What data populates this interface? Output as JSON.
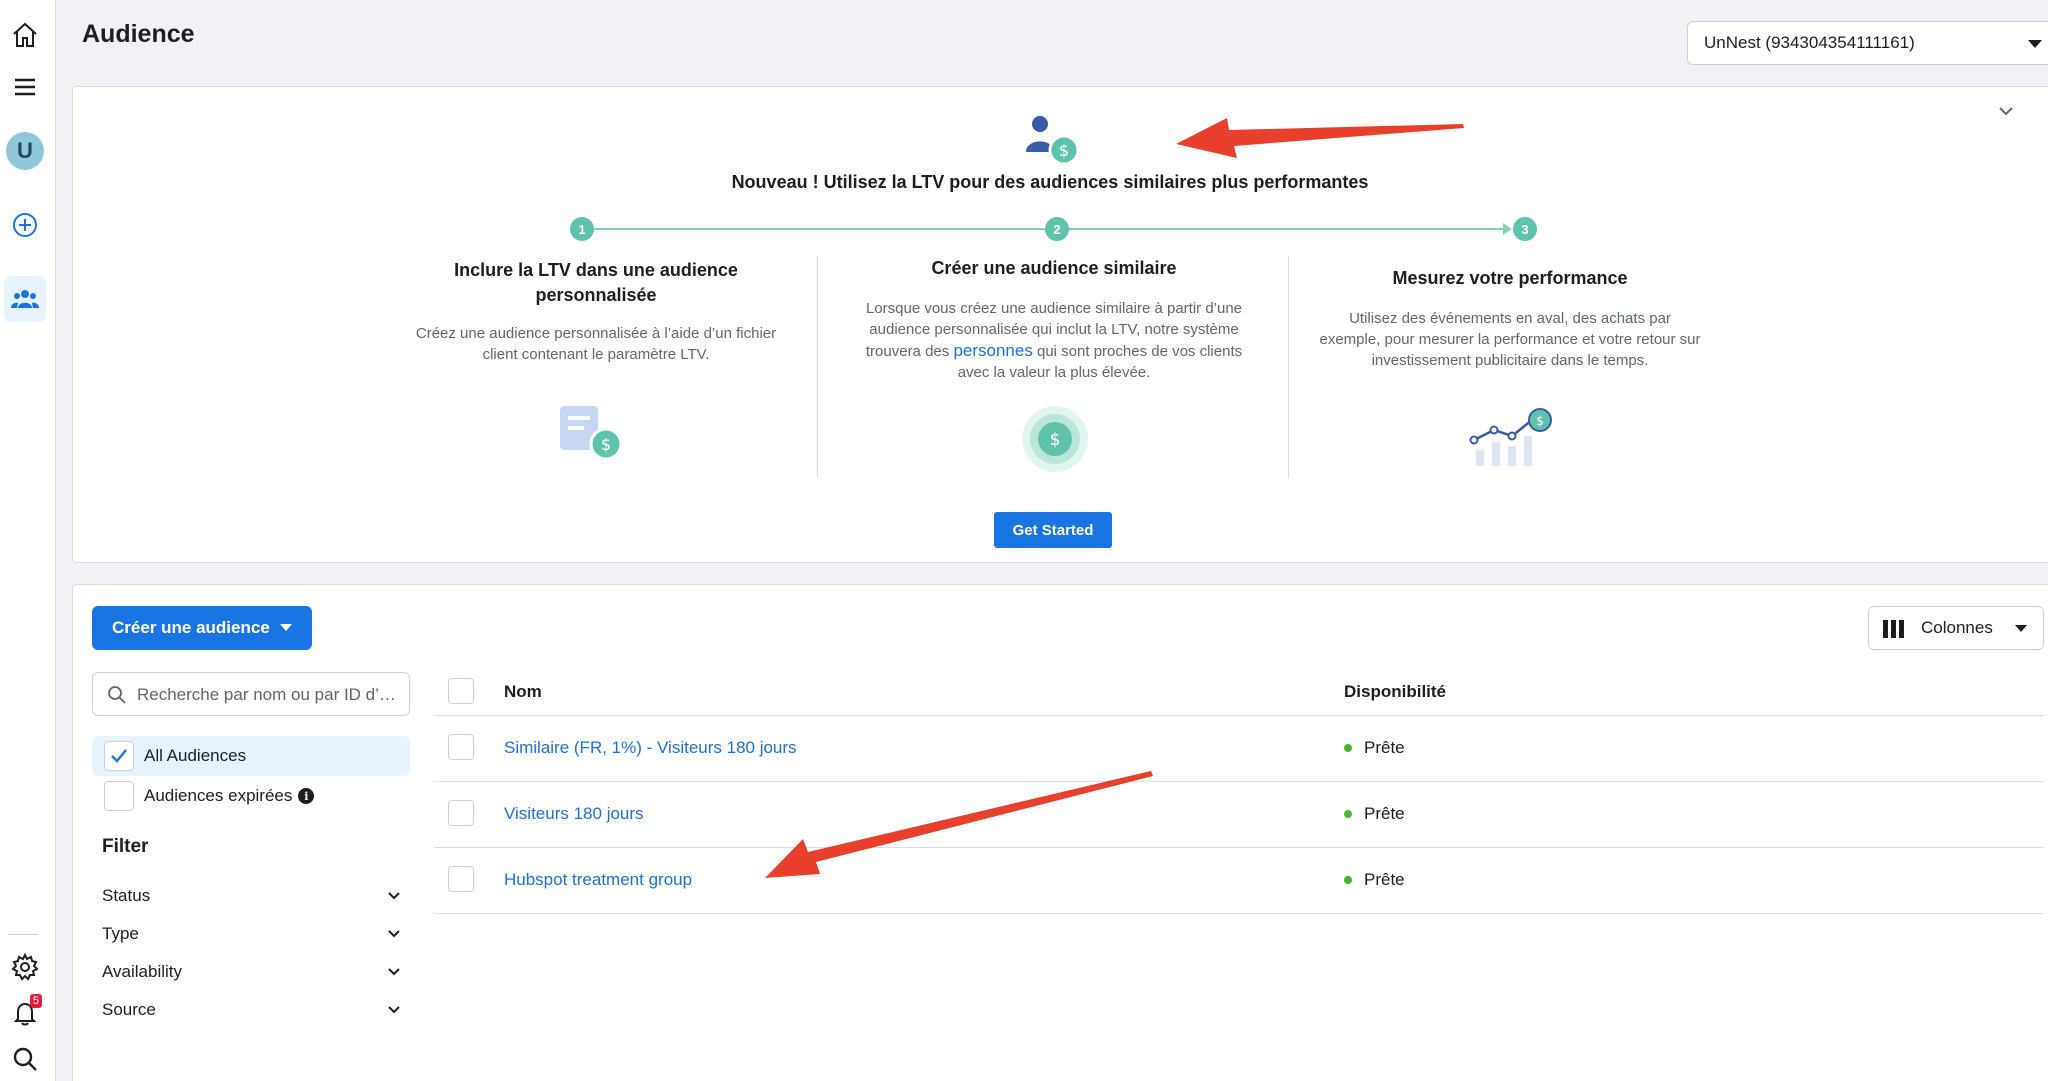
{
  "header": {
    "title": "Audience",
    "account_selector": "UnNest (934304354111161)"
  },
  "rail": {
    "avatar_letter": "U",
    "notifications_count": "5"
  },
  "promo": {
    "title": "Nouveau ! Utilisez la LTV pour des audiences similaires plus performantes",
    "steps": [
      {
        "number": "1",
        "title": "Inclure la LTV dans une audience personnalisée",
        "text": "Créez une audience personnalisée à l’aide d’un fichier client contenant le paramètre LTV."
      },
      {
        "number": "2",
        "title": "Créer une audience similaire",
        "text_before": "Lorsque vous créez une audience similaire à partir d’une audience personnalisée qui inclut la LTV, notre système trouvera des",
        "link": "personnes",
        "text_after": "qui sont proches de vos clients avec la valeur la plus élevée."
      },
      {
        "number": "3",
        "title": "Mesurez votre performance",
        "text": "Utilisez des événements en aval, des achats par exemple, pour mesurer la performance et votre retour sur investissement publicitaire dans le temps."
      }
    ],
    "cta_label": "Get Started"
  },
  "toolbar": {
    "create_label": "Créer une audience",
    "columns_label": "Colonnes"
  },
  "sidebar": {
    "search_placeholder": "Recherche par nom ou par ID d’…",
    "views": [
      {
        "label": "All Audiences",
        "checked": true
      },
      {
        "label": "Audiences expirées",
        "checked": false
      }
    ],
    "filter_heading": "Filter",
    "facets": [
      "Status",
      "Type",
      "Availability",
      "Source"
    ]
  },
  "table": {
    "columns": [
      "Nom",
      "Disponibilité"
    ],
    "rows": [
      {
        "name": "Similaire (FR, 1%) - Visiteurs 180 jours",
        "status": "Prête"
      },
      {
        "name": "Visiteurs 180 jours",
        "status": "Prête"
      },
      {
        "name": "Hubspot treatment group",
        "status": "Prête"
      }
    ]
  },
  "colors": {
    "brand_blue": "#1b74e4",
    "link_blue": "#216fdb",
    "teal": "#5fc3ac",
    "status_green": "#42b72a",
    "annotation_red": "#e8402d"
  }
}
